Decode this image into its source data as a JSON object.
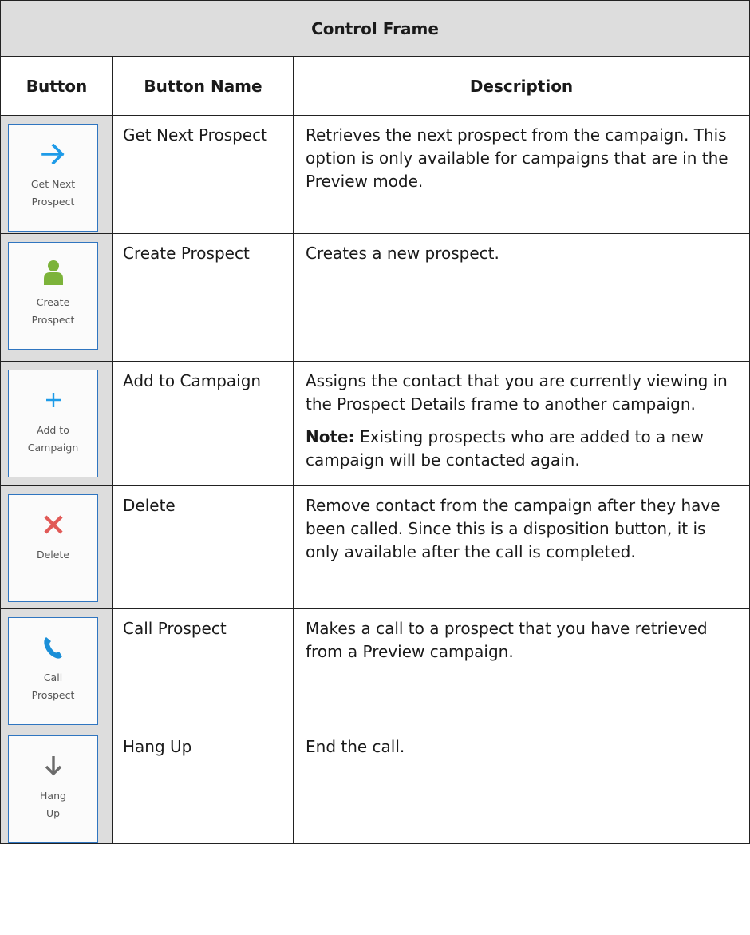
{
  "table": {
    "title": "Control Frame",
    "headers": {
      "button": "Button",
      "button_name": "Button Name",
      "description": "Description"
    },
    "rows": [
      {
        "icon": "arrow-right-icon",
        "icon_color": "#1e9be8",
        "button_label": "Get Next\nProspect",
        "name": "Get Next Prospect",
        "description": "Retrieves the next prospect from the campaign. This option is only available for campaigns that are in the Preview mode."
      },
      {
        "icon": "person-icon",
        "icon_color": "#7cb33a",
        "button_label": "Create\nProspect",
        "name": "Create Prospect",
        "description": "Creates a new prospect."
      },
      {
        "icon": "plus-icon",
        "icon_color": "#1e9be8",
        "button_label": "Add to\nCampaign",
        "name": "Add to Campaign",
        "description": "Assigns the contact that you are currently viewing in the Prospect Details frame to another campaign.",
        "note_label": "Note:",
        "note_text": " Existing prospects who are added to a new campaign will be contacted again."
      },
      {
        "icon": "x-icon",
        "icon_color": "#e15a57",
        "button_label": "Delete",
        "name": "Delete",
        "description": "Remove contact from the campaign after they have been called. Since this is a disposition button, it is only available after the call is completed."
      },
      {
        "icon": "phone-icon",
        "icon_color": "#1b8fd8",
        "button_label": "Call\nProspect",
        "name": "Call Prospect",
        "description": "Makes a call to a prospect that you have retrieved from a Preview campaign."
      },
      {
        "icon": "arrow-down-icon",
        "icon_color": "#6b6b6b",
        "button_label": "Hang\nUp",
        "name": "Hang Up",
        "description": "End the call."
      }
    ]
  }
}
